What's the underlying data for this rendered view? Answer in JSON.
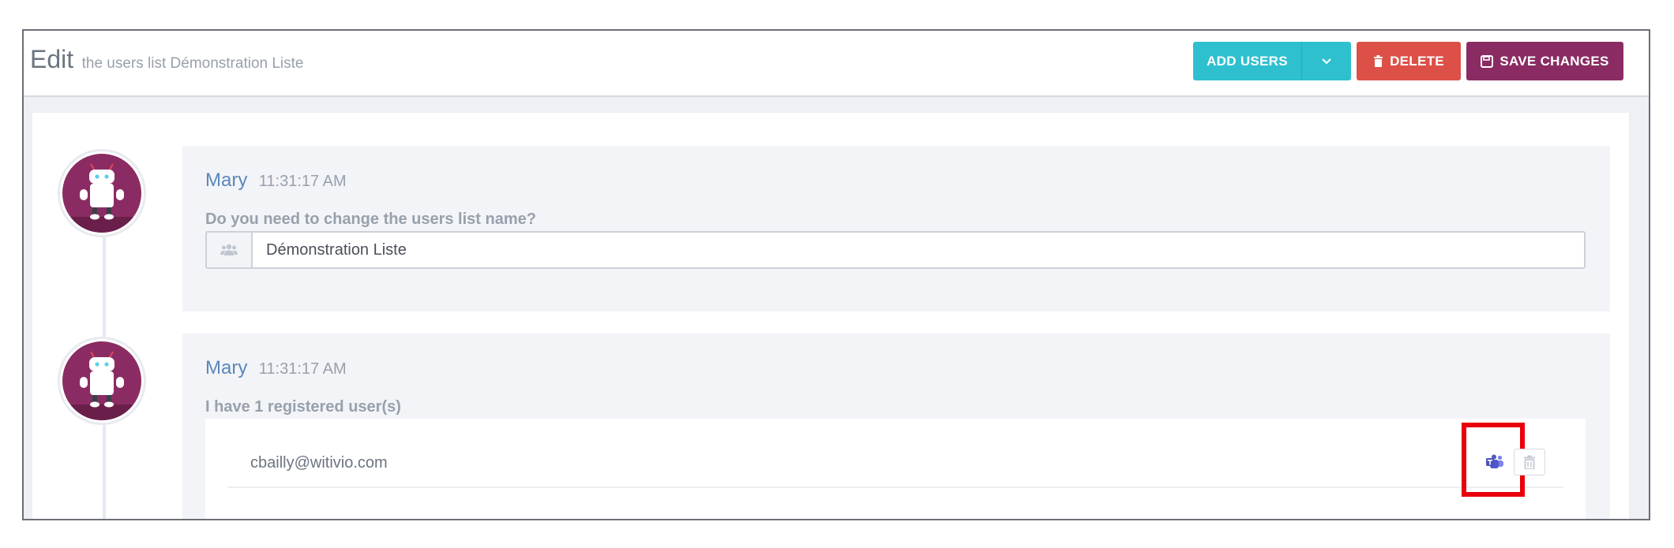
{
  "header": {
    "title": "Edit",
    "subtitle": "the users list Démonstration Liste",
    "add_users_label": "ADD USERS",
    "delete_label": "DELETE",
    "save_label": "SAVE CHANGES"
  },
  "colors": {
    "add": "#2fc0cf",
    "delete": "#dd5048",
    "save": "#8a2c63",
    "avatar_bg": "#8a2c63",
    "author": "#5b88b8",
    "highlight": "#e8000b"
  },
  "messages": [
    {
      "author": "Mary",
      "time": "11:31:17 AM",
      "question": "Do you need to change the users list name?",
      "input_value": "Démonstration Liste",
      "input_icon": "users-icon"
    },
    {
      "author": "Mary",
      "time": "11:31:17 AM",
      "question": "I have 1 registered user(s)",
      "users": [
        {
          "email": "cbailly@witivio.com",
          "actions": [
            "teams-icon",
            "trash-icon"
          ]
        }
      ]
    }
  ]
}
